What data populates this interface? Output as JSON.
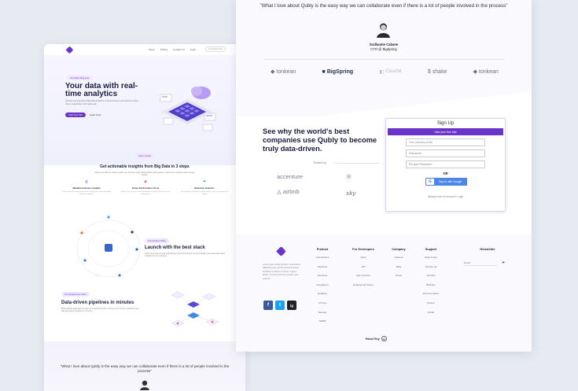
{
  "left": {
    "nav": {
      "links": [
        "About",
        "Pricing",
        "Contact Us",
        "Login"
      ],
      "cta": "Get Started Now"
    },
    "hero": {
      "pill": "Our latest blog post",
      "title": "Your data with real-time analytics",
      "subtitle": "Harness the potential of Big Data Analytics & Cloud Services and become a data-driven organization with Qubly Lab",
      "primary": "Start Free Trial",
      "secondary": "Learn more"
    },
    "steps": {
      "pill": "How it works",
      "title": "Get actionable insights from Big Data in 3 steps",
      "subtitle": "Simple and efficient steps to reach your business goals. Build reliable data pipelines, launch your analytics stack and get insights.",
      "items": [
        {
          "title": "Valuable business insights",
          "text": "Collect data from any source and let Qubly turn it into actionable business insights."
        },
        {
          "title": "Power-Performance Tools",
          "text": "Build on top of proven tools designed for speed and scale in any environment."
        },
        {
          "title": "Real-time analytics",
          "text": "Get notified in real time on what matters and stay ahead of the market."
        }
      ]
    },
    "stack": {
      "pill": "Our Product Stack",
      "title": "Launch with the best stack",
      "subtitle": "Qubly uses best-in-class technologies and best practices to build scalable, fast and reliable data solutions for your business."
    },
    "pipeline": {
      "pill": "Our Engineering Team",
      "title": "Data-driven pipelines in minutes",
      "subtitle": "Build reliable data pipelines with our engineering team. Connect your sources, transform your data and load it anywhere in minutes."
    },
    "quote": "\"What I love about Qubly is the easy way we can collaborate even if there is a lot of people involved in the process\""
  },
  "right": {
    "quote": "\"What I love about Qubly is the easy way we can collaborate even if there is a lot of people involved in the process\"",
    "person_name": "Guillaume Cabane",
    "person_role": "CTO @ BigSpring",
    "brands": [
      "tonkean",
      "BigSpring",
      "Clearbit",
      "shake",
      "tonkean"
    ],
    "headline": "See why the world's best companies use Qubly to become truly data-driven.",
    "trusted_by": "Trusted by",
    "trusted_logos": [
      "accenture",
      "airbnb",
      "react",
      "sky"
    ],
    "signup": {
      "title": "Sign Up",
      "trial": "Start your free trial",
      "email_placeholder": "Your primary email",
      "password_placeholder": "Password",
      "retype_placeholder": "Re-type Password",
      "or": "OR",
      "google": "Sign in with Google",
      "login_link": "Already have an account? Login"
    },
    "footer": {
      "about": "Lorem ipsum dolor sit amet, consectetur adipisicing elit, sed do eiusmod tempor incididunt ut labore et dolore magna aliqua. Ut enim ad minim veniam, quis nostrud.",
      "socials": [
        "f",
        "t",
        "ig"
      ],
      "columns": [
        {
          "title": "Product",
          "items": [
            "Connections",
            "Pipelines",
            "Personas",
            "Integrations",
            "Enabling",
            "Pricing",
            "Security",
            "GDPR"
          ]
        },
        {
          "title": "For Developers",
          "items": [
            "Docs",
            "API",
            "Open Source",
            "Engineering Teams"
          ]
        },
        {
          "title": "Company",
          "items": [
            "Careers",
            "Blog",
            "Press"
          ]
        },
        {
          "title": "Support",
          "items": [
            "Help Center",
            "Contact Us",
            "Security",
            "Bulletins",
            "Documentation",
            "Partner",
            "Portal"
          ]
        }
      ],
      "newsletter_title": "Newsletter",
      "newsletter_placeholder": "Email",
      "credit": "Rahul Roy"
    }
  },
  "colors": {
    "brand": "#6a34c9",
    "google": "#4c86e8",
    "facebook": "#3b5998",
    "twitter": "#1da1f2",
    "instagram": "#222222"
  }
}
